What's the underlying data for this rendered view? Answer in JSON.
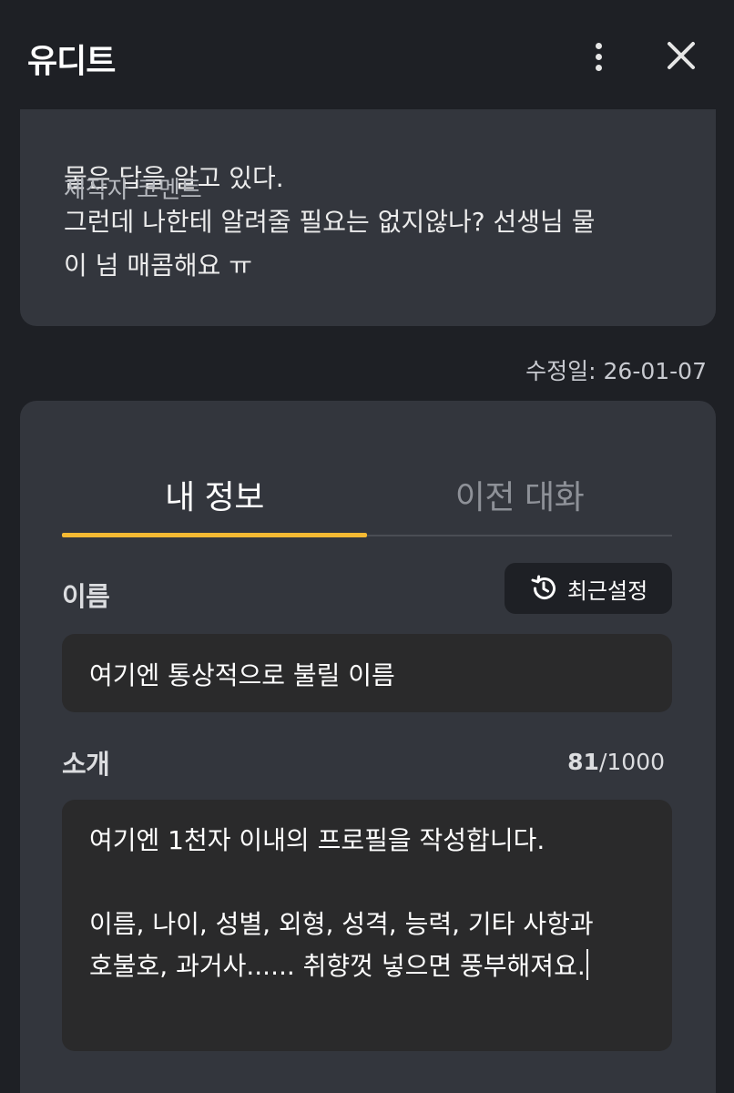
{
  "header": {
    "title": "유디트"
  },
  "comment": {
    "label": "제작자 코멘트",
    "text": "물은 답을 알고 있다.\n그런데 나한테 알려줄 필요는 없지않나? 선생님 물\n이 넘 매콤해요 ㅠ",
    "modified_date": "수정일: 26-01-07"
  },
  "tabs": [
    {
      "label": "내 정보",
      "active": true
    },
    {
      "label": "이전 대화",
      "active": false
    }
  ],
  "profile": {
    "name_label": "이름",
    "recent_button_label": "최근설정",
    "name_value": "여기엔 통상적으로 불릴 이름",
    "intro_label": "소개",
    "intro_count": "81",
    "intro_max": "/1000",
    "intro_value": "여기엔 1천자 이내의 프로필을 작성합니다.\n\n이름, 나이, 성별, 외형, 성격, 능력, 기타 사항과\n호불호, 과거사...... 취향껏 넣으면 풍부해져요."
  },
  "colors": {
    "background": "#1e2025",
    "card": "#33363d",
    "accent": "#f5b933",
    "input": "#2a2a2b"
  },
  "icons": {
    "more": "more-vertical-icon",
    "close": "close-icon",
    "recent": "history-icon"
  }
}
